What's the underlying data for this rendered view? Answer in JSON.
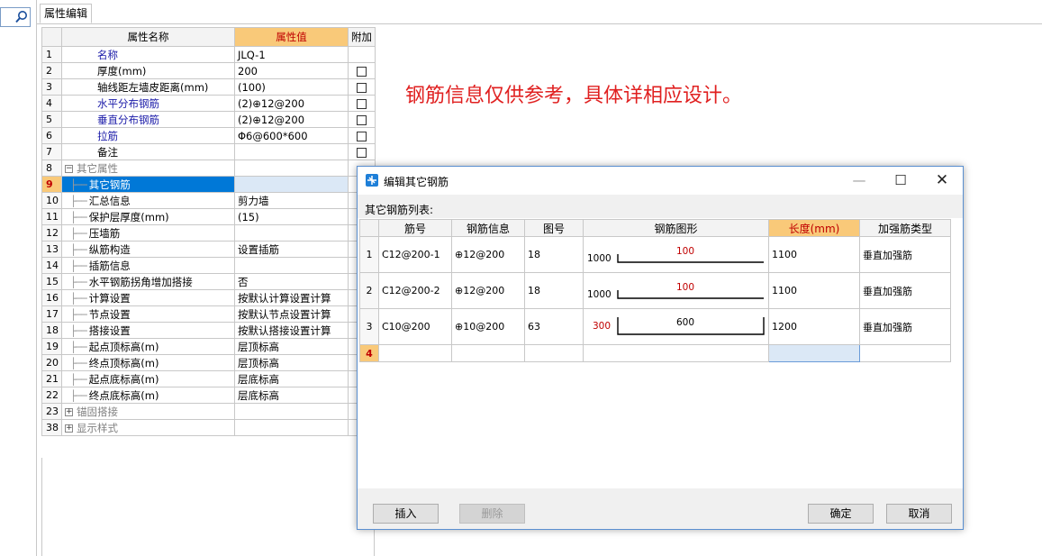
{
  "tab": {
    "label": "属性编辑"
  },
  "prop_grid": {
    "headers": {
      "name": "属性名称",
      "value": "属性值",
      "extra": "附加"
    },
    "rows": [
      {
        "num": "1",
        "name": "名称",
        "value": "JLQ-1",
        "style": "blue",
        "indent": 0,
        "check": false
      },
      {
        "num": "2",
        "name": "厚度(mm)",
        "value": "200",
        "style": "normal",
        "indent": 0,
        "check": true
      },
      {
        "num": "3",
        "name": "轴线距左墙皮距离(mm)",
        "value": "(100)",
        "style": "normal",
        "indent": 0,
        "check": true
      },
      {
        "num": "4",
        "name": "水平分布钢筋",
        "value": "(2)⊕12@200",
        "style": "blue",
        "indent": 0,
        "check": true
      },
      {
        "num": "5",
        "name": "垂直分布钢筋",
        "value": "(2)⊕12@200",
        "style": "blue",
        "indent": 0,
        "check": true
      },
      {
        "num": "6",
        "name": "拉筋",
        "value": "Φ6@600*600",
        "style": "blue",
        "indent": 0,
        "check": true
      },
      {
        "num": "7",
        "name": "备注",
        "value": "",
        "style": "normal",
        "indent": 0,
        "check": true
      },
      {
        "num": "8",
        "name": "其它属性",
        "value": "",
        "style": "group-open",
        "indent": 0,
        "check": false
      },
      {
        "num": "9",
        "name": "其它钢筋",
        "value": "",
        "style": "selected",
        "indent": 1,
        "check": false
      },
      {
        "num": "10",
        "name": "汇总信息",
        "value": "剪力墙",
        "style": "normal",
        "indent": 1,
        "check": true
      },
      {
        "num": "11",
        "name": "保护层厚度(mm)",
        "value": "(15)",
        "style": "normal",
        "indent": 1,
        "check": true
      },
      {
        "num": "12",
        "name": "压墙筋",
        "value": "",
        "style": "normal",
        "indent": 1,
        "check": true
      },
      {
        "num": "13",
        "name": "纵筋构造",
        "value": "设置插筋",
        "style": "normal",
        "indent": 1,
        "check": true
      },
      {
        "num": "14",
        "name": "插筋信息",
        "value": "",
        "style": "normal",
        "indent": 1,
        "check": true
      },
      {
        "num": "15",
        "name": "水平钢筋拐角增加搭接",
        "value": "否",
        "style": "normal",
        "indent": 1,
        "check": true
      },
      {
        "num": "16",
        "name": "计算设置",
        "value": "按默认计算设置计算",
        "style": "normal",
        "indent": 1,
        "check": true
      },
      {
        "num": "17",
        "name": "节点设置",
        "value": "按默认节点设置计算",
        "style": "normal",
        "indent": 1,
        "check": true
      },
      {
        "num": "18",
        "name": "搭接设置",
        "value": "按默认搭接设置计算",
        "style": "normal",
        "indent": 1,
        "check": true
      },
      {
        "num": "19",
        "name": "起点顶标高(m)",
        "value": "层顶标高",
        "style": "normal",
        "indent": 1,
        "check": true
      },
      {
        "num": "20",
        "name": "终点顶标高(m)",
        "value": "层顶标高",
        "style": "normal",
        "indent": 1,
        "check": true
      },
      {
        "num": "21",
        "name": "起点底标高(m)",
        "value": "层底标高",
        "style": "normal",
        "indent": 1,
        "check": true
      },
      {
        "num": "22",
        "name": "终点底标高(m)",
        "value": "层底标高",
        "style": "normal",
        "indent": 1,
        "check": true
      },
      {
        "num": "23",
        "name": "锚固搭接",
        "value": "",
        "style": "group-closed",
        "indent": 0,
        "check": false
      },
      {
        "num": "38",
        "name": "显示样式",
        "value": "",
        "style": "group-closed",
        "indent": 0,
        "check": false
      }
    ]
  },
  "note": "钢筋信息仅供参考，具体详相应设计。",
  "dialog": {
    "title": "编辑其它钢筋",
    "min": "—",
    "max": "☐",
    "close": "✕",
    "list_label": "其它钢筋列表:",
    "headers": [
      "筋号",
      "钢筋信息",
      "图号",
      "钢筋图形",
      "长度(mm)",
      "加强筋类型"
    ],
    "rows": [
      {
        "num": "1",
        "id": "C12@200-1",
        "info": "⊕12@200",
        "fig": "18",
        "shape_left": "1000",
        "shape_mid": "100",
        "shape_kind": "18",
        "length": "1100",
        "type": "垂直加强筋"
      },
      {
        "num": "2",
        "id": "C12@200-2",
        "info": "⊕12@200",
        "fig": "18",
        "shape_left": "1000",
        "shape_mid": "100",
        "shape_kind": "18",
        "length": "1100",
        "type": "垂直加强筋"
      },
      {
        "num": "3",
        "id": "C10@200",
        "info": "⊕10@200",
        "fig": "63",
        "shape_left": "300",
        "shape_mid": "600",
        "shape_kind": "63",
        "length": "1200",
        "type": "垂直加强筋"
      }
    ],
    "new_row_num": "4",
    "buttons": {
      "insert": "插入",
      "delete": "删除",
      "ok": "确定",
      "cancel": "取消"
    }
  }
}
